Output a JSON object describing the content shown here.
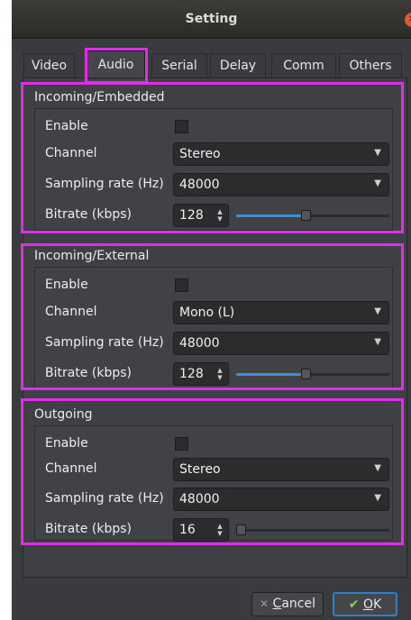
{
  "window": {
    "title": "Setting",
    "close_icon": "close-icon"
  },
  "tabs": [
    {
      "label": "Video",
      "active": false
    },
    {
      "label": "Audio",
      "active": true
    },
    {
      "label": "Serial",
      "active": false
    },
    {
      "label": "Delay",
      "active": false
    },
    {
      "label": "Comm",
      "active": false
    },
    {
      "label": "Others",
      "active": false
    }
  ],
  "groups": [
    {
      "title": "Incoming/Embedded",
      "enable_label": "Enable",
      "enabled": false,
      "channel_label": "Channel",
      "channel_value": "Stereo",
      "rate_label": "Sampling rate (Hz)",
      "rate_value": "48000",
      "bitrate_label": "Bitrate (kbps)",
      "bitrate_value": "128",
      "bitrate_level": 0.45
    },
    {
      "title": "Incoming/External",
      "enable_label": "Enable",
      "enabled": false,
      "channel_label": "Channel",
      "channel_value": "Mono (L)",
      "rate_label": "Sampling rate (Hz)",
      "rate_value": "48000",
      "bitrate_label": "Bitrate (kbps)",
      "bitrate_value": "128",
      "bitrate_level": 0.45
    },
    {
      "title": "Outgoing",
      "enable_label": "Enable",
      "enabled": false,
      "channel_label": "Channel",
      "channel_value": "Stereo",
      "rate_label": "Sampling rate (Hz)",
      "rate_value": "48000",
      "bitrate_label": "Bitrate (kbps)",
      "bitrate_value": "16",
      "bitrate_level": 0.0
    }
  ],
  "buttons": {
    "cancel_prefix": "",
    "cancel_underline": "C",
    "cancel_rest": "ancel",
    "ok_underline": "O",
    "ok_rest": "K"
  },
  "colors": {
    "highlight": "#e02ee8",
    "accent": "#3d8fd9",
    "background": "#3a3b3e"
  }
}
